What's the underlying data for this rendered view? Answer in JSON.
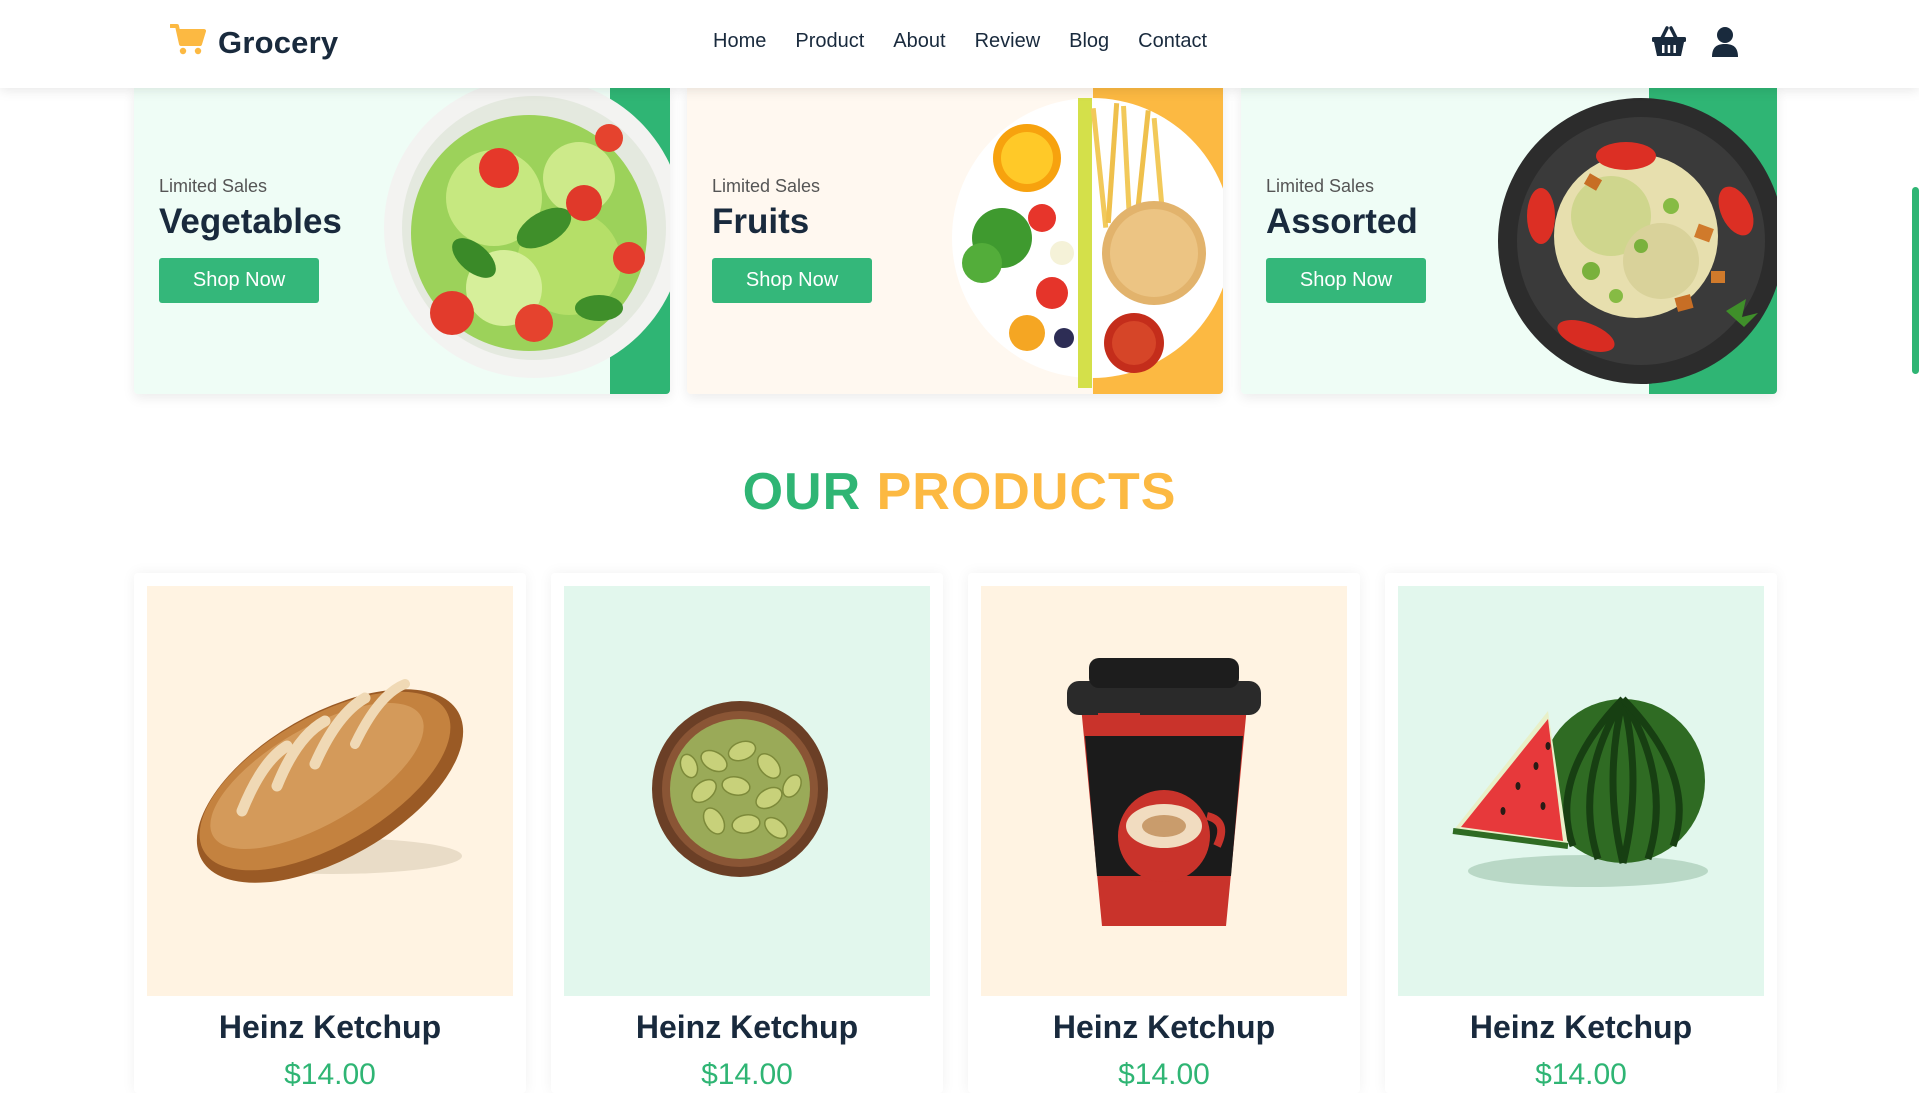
{
  "header": {
    "brand": "Grocery",
    "nav": [
      "Home",
      "Product",
      "About",
      "Review",
      "Blog",
      "Contact"
    ],
    "icons": [
      "cart-icon",
      "basket-icon",
      "user-icon"
    ]
  },
  "promos": [
    {
      "small": "Limited Sales",
      "title": "Vegetables",
      "button": "Shop Now",
      "bg": "#effdf6",
      "accent": "#2fb574"
    },
    {
      "small": "Limited Sales",
      "title": "Fruits",
      "button": "Shop Now",
      "bg": "#fff8f0",
      "accent": "#fcb942"
    },
    {
      "small": "Limited Sales",
      "title": "Assorted",
      "button": "Shop Now",
      "bg": "#effdf6",
      "accent": "#2fb574"
    }
  ],
  "section": {
    "title_part1": "OUR",
    "title_part2": "PRODUCTS"
  },
  "products": [
    {
      "name": "Heinz Ketchup",
      "price": "$14.00",
      "bg": "#fff3e2"
    },
    {
      "name": "Heinz Ketchup",
      "price": "$14.00",
      "bg": "#e2f7ed"
    },
    {
      "name": "Heinz Ketchup",
      "price": "$14.00",
      "bg": "#fff3e2"
    },
    {
      "name": "Heinz Ketchup",
      "price": "$14.00",
      "bg": "#e2f7ed"
    }
  ],
  "colors": {
    "green": "#2fb574",
    "orange": "#fcb942",
    "dark": "#192a3d"
  }
}
